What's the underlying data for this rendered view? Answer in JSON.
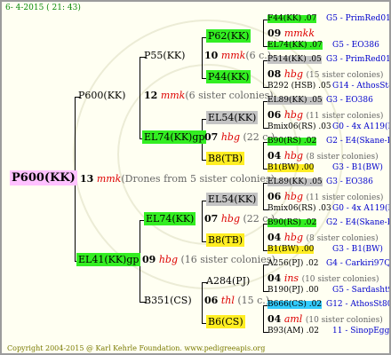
{
  "header": "6-  4-2015 ( 21: 43)",
  "footer": "Copyright 2004-2015 @ Karl Kehrle Foundation.   www.pedigreeapis.org",
  "root": {
    "label": "P600(KK)",
    "num": "13",
    "queen": "mmk",
    "note": "(Drones from 5 sister colonies)"
  },
  "g1": [
    {
      "label": "P600(KK)",
      "num": "12",
      "queen": "mmk",
      "note": "(6 sister colonies)"
    },
    {
      "label": "EL41(KK)gp",
      "num": "09",
      "queen": "hbg",
      "note": "(16 sister colonies)"
    }
  ],
  "g2": [
    {
      "label": "P55(KK)",
      "num": "10",
      "queen": "mmk",
      "note": "(6 c.)"
    },
    {
      "label": "EL74(KK)gp",
      "num": "07",
      "queen": "hbg",
      "note": "(22 c.)"
    },
    {
      "label": "EL74(KK)",
      "num": "07",
      "queen": "hbg",
      "note": "(22 c.)"
    },
    {
      "label": "B351(CS)",
      "num": "06",
      "queen": "thl",
      "note": "(15 c.)"
    }
  ],
  "g3": [
    "P62(KK)",
    "P44(KK)",
    "EL54(KK)",
    "B8(TB)",
    "EL54(KK)",
    "B8(TB)",
    "A284(PJ)",
    "B6(CS)"
  ],
  "g4": [
    {
      "top": "F44(KK) .07",
      "topr": "G5 - PrimRed01",
      "num": "09",
      "queen": "mmkk",
      "note": "",
      "bottom": "EL74(KK) .07",
      "bottomr": "G5 - EO386"
    },
    {
      "top": "P514(KK) .05",
      "topr": "G3 - PrimRed01",
      "num": "08",
      "queen": "hbg",
      "note": "(15 sister colonies)",
      "bottom": "B292 (HSB) .05",
      "bottomr": "G14 - AthosSt80R"
    },
    {
      "top": "EL89(KK) .05",
      "topr": "G3 - EO386",
      "num": "06",
      "queen": "hbg",
      "note": "(11 sister colonies)",
      "bottom": "Bmix06(RS) .03",
      "bottomr": "G0 - 4x A119(RS)"
    },
    {
      "top": "B90(RS) .02",
      "topr": "G2 - E4(Skane-B)",
      "num": "04",
      "queen": "hbg",
      "note": "(8 sister colonies)",
      "bottom": "B1(BW) .00",
      "bottomr": "G3 - B1(BW)"
    },
    {
      "top": "EL89(KK) .05",
      "topr": "G3 - EO386",
      "num": "06",
      "queen": "hbg",
      "note": "(11 sister colonies)",
      "bottom": "Bmix06(RS) .03",
      "bottomr": "G0 - 4x A119(RS)"
    },
    {
      "top": "B90(RS) .02",
      "topr": "G2 - E4(Skane-B)",
      "num": "04",
      "queen": "hbg",
      "note": "(8 sister colonies)",
      "bottom": "B1(BW) .00",
      "bottomr": "G3 - B1(BW)"
    },
    {
      "top": "A256(PJ) .02",
      "topr": "G4 - Carkiri97Q",
      "num": "04",
      "queen": "ins",
      "note": "(10 sister colonies)",
      "bottom": "B190(PJ) .00",
      "bottomr": "G5 - Sardasht93R"
    },
    {
      "top": "B666(CS) .02",
      "topr": "G12 - AthosSt80R",
      "num": "04",
      "queen": "aml",
      "note": "(10 sister colonies)",
      "bottom": "B93(AM) .02",
      "bottomr": "11 - SinopEgg86R"
    }
  ],
  "colors": {
    "green": "#33ee22",
    "gray": "#c4c4c4",
    "yellow": "#ffee22",
    "pink": "#ffc2ff",
    "cyan": "#33ccff",
    "red": "#dd0000",
    "blue": "#0000cc"
  }
}
